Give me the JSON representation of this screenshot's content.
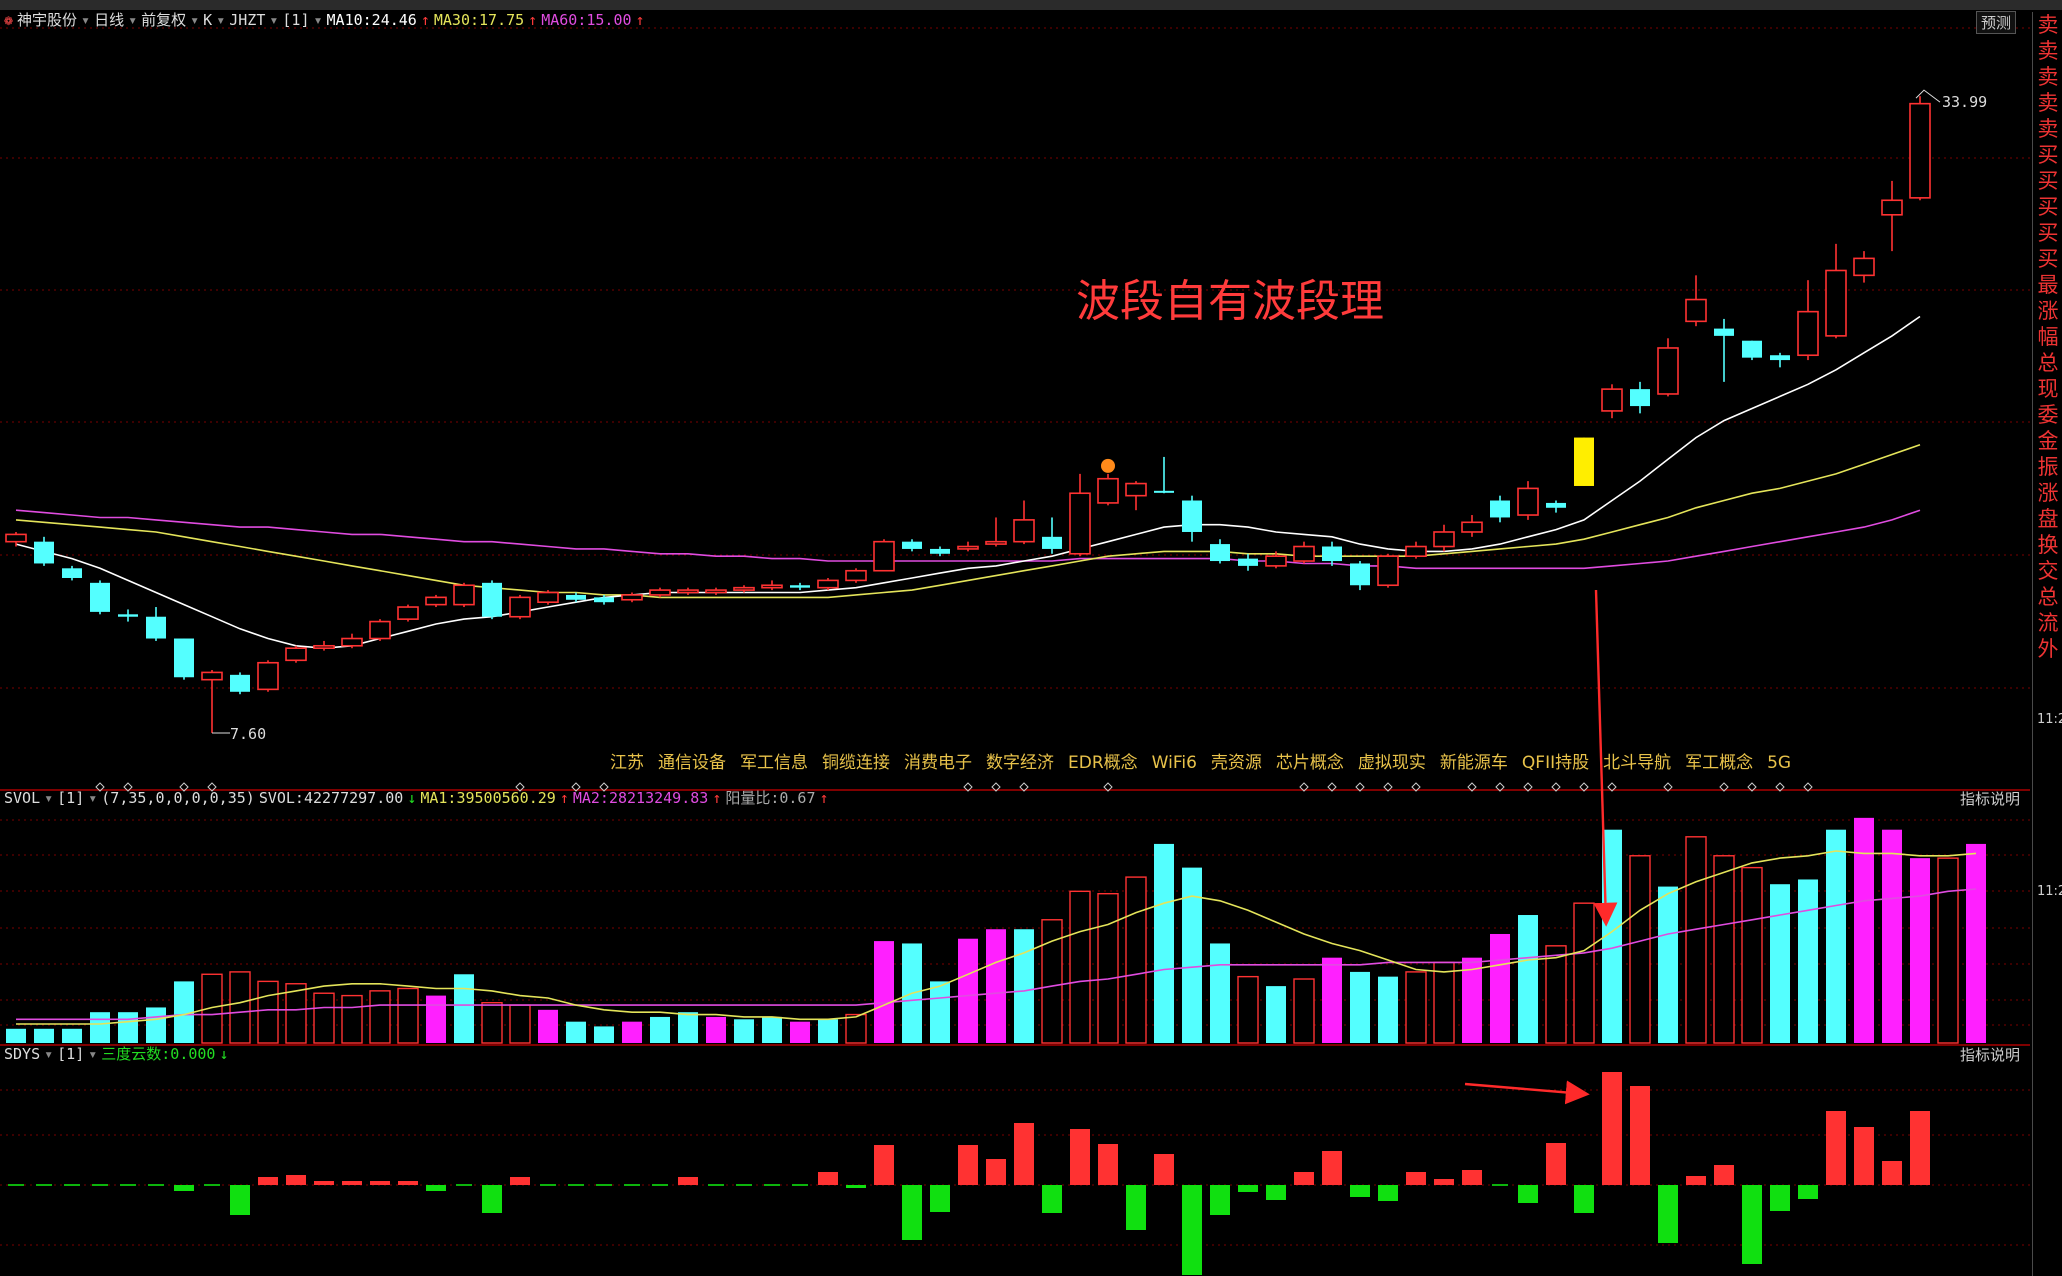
{
  "header": {
    "stock_name": "神宇股份",
    "period": "日线",
    "adjust": "前复权",
    "chart_kind": "K",
    "indicator": "JHZT",
    "bracket": "[1]",
    "ma10": "MA10:24.46",
    "ma30": "MA30:17.75",
    "ma60": "MA60:15.00",
    "forecast_button": "预测"
  },
  "volume_header": {
    "name": "SVOL",
    "bracket": "[1]",
    "params": "(7,35,0,0,0,0,35)",
    "svol": "SVOL:42277297.00",
    "ma1": "MA1:39500560.29",
    "ma2": "MA2:28213249.83",
    "ratio": "阳量比:0.67",
    "help": "指标说明"
  },
  "sdys_header": {
    "name": "SDYS",
    "bracket": "[1]",
    "value": "三度云数:0.000",
    "help": "指标说明"
  },
  "annotation": "波段自有波段理",
  "concepts": [
    "江苏",
    "通信设备",
    "军工信息",
    "铜缆连接",
    "消费电子",
    "数字经济",
    "EDR概念",
    "WiFi6",
    "壳资源",
    "芯片概念",
    "虚拟现实",
    "新能源车",
    "QFII持股",
    "北斗导航",
    "军工概念",
    "5G"
  ],
  "right_panel": {
    "chars": [
      "卖",
      "卖",
      "卖",
      "卖",
      "卖",
      "买",
      "买",
      "买",
      "买",
      "买",
      "最",
      "涨",
      "幅",
      "总",
      "现",
      "委",
      "金",
      "振",
      "涨",
      "盘",
      "换",
      "交",
      "总",
      "流",
      "外"
    ],
    "time1": "11:2",
    "time2": "11:2"
  },
  "colors": {
    "up": "#ff3232",
    "down": "#54ffff",
    "ma10": "#ffffff",
    "ma30": "#e4e45a",
    "ma60": "#e04ce0",
    "grid": "#7a0000",
    "magenta_bar": "#ff20ff",
    "highlight": "#ffee00",
    "sdys_up": "#ff3232",
    "sdys_down": "#10e010"
  },
  "chart_data": [
    {
      "type": "candlestick",
      "title": "神宇股份 日线 前复权",
      "ylim": [
        6.8,
        36
      ],
      "price_max_label": "33.99",
      "price_min_label": "7.60",
      "candles": [
        {
          "o": 15.9,
          "h": 16.3,
          "l": 15.7,
          "c": 16.2,
          "color": "up"
        },
        {
          "o": 15.9,
          "h": 16.1,
          "l": 14.9,
          "c": 15.0,
          "color": "down"
        },
        {
          "o": 14.8,
          "h": 14.9,
          "l": 14.3,
          "c": 14.4,
          "color": "down"
        },
        {
          "o": 14.2,
          "h": 14.3,
          "l": 12.9,
          "c": 13.0,
          "color": "down"
        },
        {
          "o": 12.9,
          "h": 13.1,
          "l": 12.6,
          "c": 12.8,
          "color": "down"
        },
        {
          "o": 12.8,
          "h": 13.2,
          "l": 11.8,
          "c": 11.9,
          "color": "down"
        },
        {
          "o": 11.9,
          "h": 11.9,
          "l": 10.2,
          "c": 10.3,
          "color": "down"
        },
        {
          "o": 10.2,
          "h": 10.6,
          "l": 8.0,
          "c": 10.5,
          "color": "up"
        },
        {
          "o": 10.4,
          "h": 10.5,
          "l": 9.6,
          "c": 9.7,
          "color": "down"
        },
        {
          "o": 9.8,
          "h": 11.0,
          "l": 9.7,
          "c": 10.9,
          "color": "up"
        },
        {
          "o": 11.0,
          "h": 11.6,
          "l": 10.9,
          "c": 11.5,
          "color": "up"
        },
        {
          "o": 11.5,
          "h": 11.8,
          "l": 11.4,
          "c": 11.6,
          "color": "up"
        },
        {
          "o": 11.6,
          "h": 12.1,
          "l": 11.5,
          "c": 11.9,
          "color": "up"
        },
        {
          "o": 11.9,
          "h": 12.7,
          "l": 11.8,
          "c": 12.6,
          "color": "up"
        },
        {
          "o": 12.7,
          "h": 13.3,
          "l": 12.6,
          "c": 13.2,
          "color": "up"
        },
        {
          "o": 13.3,
          "h": 13.7,
          "l": 13.2,
          "c": 13.6,
          "color": "up"
        },
        {
          "o": 13.3,
          "h": 14.2,
          "l": 13.2,
          "c": 14.1,
          "color": "up"
        },
        {
          "o": 14.2,
          "h": 14.3,
          "l": 12.7,
          "c": 12.8,
          "color": "down"
        },
        {
          "o": 12.8,
          "h": 13.7,
          "l": 12.7,
          "c": 13.6,
          "color": "up"
        },
        {
          "o": 13.4,
          "h": 13.9,
          "l": 13.3,
          "c": 13.8,
          "color": "up"
        },
        {
          "o": 13.7,
          "h": 13.8,
          "l": 13.4,
          "c": 13.5,
          "color": "down"
        },
        {
          "o": 13.6,
          "h": 13.7,
          "l": 13.3,
          "c": 13.4,
          "color": "down"
        },
        {
          "o": 13.5,
          "h": 13.8,
          "l": 13.4,
          "c": 13.7,
          "color": "up"
        },
        {
          "o": 13.7,
          "h": 14.0,
          "l": 13.6,
          "c": 13.9,
          "color": "up"
        },
        {
          "o": 13.9,
          "h": 14.0,
          "l": 13.7,
          "c": 13.8,
          "color": "up"
        },
        {
          "o": 13.8,
          "h": 14.0,
          "l": 13.7,
          "c": 13.9,
          "color": "up"
        },
        {
          "o": 13.9,
          "h": 14.1,
          "l": 13.8,
          "c": 14.0,
          "color": "up"
        },
        {
          "o": 14.0,
          "h": 14.3,
          "l": 13.9,
          "c": 14.1,
          "color": "up"
        },
        {
          "o": 14.1,
          "h": 14.2,
          "l": 13.9,
          "c": 14.0,
          "color": "down"
        },
        {
          "o": 14.0,
          "h": 14.4,
          "l": 13.9,
          "c": 14.3,
          "color": "up"
        },
        {
          "o": 14.3,
          "h": 14.8,
          "l": 14.2,
          "c": 14.7,
          "color": "up"
        },
        {
          "o": 14.7,
          "h": 16.0,
          "l": 14.7,
          "c": 15.9,
          "color": "up"
        },
        {
          "o": 15.9,
          "h": 16.0,
          "l": 15.5,
          "c": 15.6,
          "color": "down"
        },
        {
          "o": 15.6,
          "h": 15.7,
          "l": 15.3,
          "c": 15.4,
          "color": "down"
        },
        {
          "o": 15.6,
          "h": 15.9,
          "l": 15.5,
          "c": 15.7,
          "color": "up"
        },
        {
          "o": 15.8,
          "h": 16.9,
          "l": 15.7,
          "c": 15.9,
          "color": "up"
        },
        {
          "o": 15.9,
          "h": 17.6,
          "l": 15.8,
          "c": 16.8,
          "color": "up"
        },
        {
          "o": 16.1,
          "h": 16.9,
          "l": 15.4,
          "c": 15.6,
          "color": "down"
        },
        {
          "o": 15.4,
          "h": 18.7,
          "l": 15.3,
          "c": 17.9,
          "color": "up"
        },
        {
          "o": 17.5,
          "h": 18.7,
          "l": 17.4,
          "c": 18.5,
          "color": "up"
        },
        {
          "o": 17.8,
          "h": 18.4,
          "l": 17.2,
          "c": 18.3,
          "color": "up"
        },
        {
          "o": 18.0,
          "h": 19.4,
          "l": 17.9,
          "c": 18.0,
          "color": "down"
        },
        {
          "o": 17.6,
          "h": 17.8,
          "l": 15.9,
          "c": 16.3,
          "color": "down"
        },
        {
          "o": 15.8,
          "h": 16.0,
          "l": 15.0,
          "c": 15.1,
          "color": "down"
        },
        {
          "o": 15.2,
          "h": 15.4,
          "l": 14.7,
          "c": 14.9,
          "color": "down"
        },
        {
          "o": 14.9,
          "h": 15.5,
          "l": 14.8,
          "c": 15.3,
          "color": "up"
        },
        {
          "o": 15.1,
          "h": 15.9,
          "l": 15.0,
          "c": 15.7,
          "color": "up"
        },
        {
          "o": 15.7,
          "h": 15.9,
          "l": 14.9,
          "c": 15.1,
          "color": "down"
        },
        {
          "o": 15.0,
          "h": 15.1,
          "l": 13.9,
          "c": 14.1,
          "color": "down"
        },
        {
          "o": 14.1,
          "h": 15.4,
          "l": 14.0,
          "c": 15.3,
          "color": "up"
        },
        {
          "o": 15.3,
          "h": 15.9,
          "l": 15.2,
          "c": 15.7,
          "color": "up"
        },
        {
          "o": 15.7,
          "h": 16.6,
          "l": 15.5,
          "c": 16.3,
          "color": "up"
        },
        {
          "o": 16.3,
          "h": 17.0,
          "l": 16.1,
          "c": 16.7,
          "color": "up"
        },
        {
          "o": 16.9,
          "h": 17.8,
          "l": 16.7,
          "c": 17.6,
          "color": "down"
        },
        {
          "o": 17.0,
          "h": 18.4,
          "l": 16.8,
          "c": 18.1,
          "color": "up"
        },
        {
          "o": 17.3,
          "h": 17.6,
          "l": 17.1,
          "c": 17.5,
          "color": "down"
        },
        {
          "o": 18.2,
          "h": 20.2,
          "l": 18.2,
          "c": 20.2,
          "color": "highlight"
        },
        {
          "o": 21.3,
          "h": 22.4,
          "l": 21.0,
          "c": 22.2,
          "color": "up"
        },
        {
          "o": 22.2,
          "h": 22.5,
          "l": 21.2,
          "c": 21.5,
          "color": "down"
        },
        {
          "o": 22.0,
          "h": 24.3,
          "l": 21.9,
          "c": 23.9,
          "color": "up"
        },
        {
          "o": 25.0,
          "h": 26.9,
          "l": 24.8,
          "c": 25.9,
          "color": "up"
        },
        {
          "o": 24.7,
          "h": 25.1,
          "l": 22.5,
          "c": 24.4,
          "color": "down"
        },
        {
          "o": 24.2,
          "h": 24.2,
          "l": 23.4,
          "c": 23.5,
          "color": "down"
        },
        {
          "o": 23.6,
          "h": 23.7,
          "l": 23.1,
          "c": 23.4,
          "color": "down"
        },
        {
          "o": 23.6,
          "h": 26.7,
          "l": 23.4,
          "c": 25.4,
          "color": "up"
        },
        {
          "o": 24.4,
          "h": 28.2,
          "l": 24.3,
          "c": 27.1,
          "color": "up"
        },
        {
          "o": 26.9,
          "h": 27.9,
          "l": 26.6,
          "c": 27.6,
          "color": "up"
        },
        {
          "o": 29.4,
          "h": 30.8,
          "l": 27.9,
          "c": 30.0,
          "color": "up"
        },
        {
          "o": 30.1,
          "h": 34.3,
          "l": 30.0,
          "c": 33.99,
          "color": "up"
        }
      ],
      "ma10": [
        15.8,
        15.5,
        15.2,
        14.8,
        14.3,
        13.8,
        13.3,
        12.8,
        12.3,
        11.9,
        11.6,
        11.5,
        11.6,
        11.9,
        12.2,
        12.5,
        12.7,
        12.8,
        13.0,
        13.2,
        13.4,
        13.6,
        13.7,
        13.8,
        13.8,
        13.8,
        13.8,
        13.8,
        13.8,
        13.9,
        14.0,
        14.2,
        14.4,
        14.6,
        14.8,
        14.9,
        15.1,
        15.3,
        15.6,
        15.9,
        16.2,
        16.5,
        16.6,
        16.6,
        16.5,
        16.3,
        16.2,
        16.1,
        15.8,
        15.6,
        15.5,
        15.5,
        15.6,
        15.8,
        16.1,
        16.4,
        16.8,
        17.6,
        18.4,
        19.3,
        20.2,
        20.9,
        21.4,
        21.9,
        22.4,
        23.0,
        23.7,
        24.4,
        25.2
      ],
      "ma30": [
        16.8,
        16.7,
        16.6,
        16.5,
        16.4,
        16.3,
        16.1,
        15.9,
        15.7,
        15.5,
        15.3,
        15.1,
        14.9,
        14.7,
        14.5,
        14.3,
        14.1,
        14.0,
        13.9,
        13.8,
        13.8,
        13.7,
        13.7,
        13.6,
        13.6,
        13.6,
        13.6,
        13.6,
        13.6,
        13.6,
        13.7,
        13.8,
        13.9,
        14.1,
        14.3,
        14.5,
        14.7,
        14.9,
        15.1,
        15.3,
        15.4,
        15.5,
        15.5,
        15.5,
        15.4,
        15.4,
        15.3,
        15.3,
        15.3,
        15.3,
        15.3,
        15.4,
        15.5,
        15.6,
        15.7,
        15.8,
        16.0,
        16.3,
        16.6,
        16.9,
        17.3,
        17.6,
        17.9,
        18.1,
        18.4,
        18.7,
        19.1,
        19.5,
        19.9
      ],
      "ma60": [
        17.2,
        17.1,
        17.0,
        16.9,
        16.9,
        16.8,
        16.7,
        16.6,
        16.5,
        16.5,
        16.4,
        16.3,
        16.2,
        16.2,
        16.1,
        16.0,
        15.9,
        15.9,
        15.8,
        15.7,
        15.6,
        15.6,
        15.5,
        15.4,
        15.4,
        15.3,
        15.3,
        15.2,
        15.2,
        15.1,
        15.1,
        15.1,
        15.1,
        15.1,
        15.1,
        15.1,
        15.1,
        15.1,
        15.2,
        15.2,
        15.2,
        15.2,
        15.2,
        15.2,
        15.1,
        15.1,
        15.0,
        15.0,
        14.9,
        14.9,
        14.8,
        14.8,
        14.8,
        14.8,
        14.8,
        14.8,
        14.8,
        14.9,
        15.0,
        15.1,
        15.3,
        15.5,
        15.7,
        15.9,
        16.1,
        16.3,
        16.5,
        16.8,
        17.2
      ]
    },
    {
      "type": "bar",
      "title": "SVOL",
      "ylim": [
        0,
        1
      ],
      "volume": [
        0.06,
        0.06,
        0.06,
        0.13,
        0.13,
        0.15,
        0.26,
        0.29,
        0.3,
        0.26,
        0.25,
        0.21,
        0.2,
        0.22,
        0.23,
        0.2,
        0.29,
        0.17,
        0.16,
        0.14,
        0.09,
        0.07,
        0.09,
        0.11,
        0.13,
        0.11,
        0.1,
        0.11,
        0.09,
        0.1,
        0.12,
        0.43,
        0.42,
        0.26,
        0.44,
        0.48,
        0.48,
        0.52,
        0.64,
        0.63,
        0.7,
        0.84,
        0.74,
        0.42,
        0.28,
        0.24,
        0.27,
        0.36,
        0.3,
        0.28,
        0.3,
        0.34,
        0.36,
        0.46,
        0.54,
        0.41,
        0.59,
        0.9,
        0.79,
        0.66,
        0.87,
        0.79,
        0.74,
        0.67,
        0.69,
        0.9,
        0.95,
        0.9,
        0.78,
        0.78,
        0.84
      ],
      "bar_style": [
        "c",
        "c",
        "c",
        "c",
        "c",
        "c",
        "c",
        "h",
        "h",
        "h",
        "h",
        "h",
        "h",
        "h",
        "h",
        "m",
        "c",
        "h",
        "h",
        "m",
        "c",
        "c",
        "m",
        "c",
        "c",
        "m",
        "c",
        "c",
        "m",
        "c",
        "h",
        "m",
        "c",
        "c",
        "m",
        "m",
        "c",
        "h",
        "h",
        "h",
        "h",
        "c",
        "c",
        "c",
        "h",
        "c",
        "h",
        "m",
        "c",
        "c",
        "h",
        "h",
        "m",
        "m",
        "c",
        "h",
        "h",
        "c",
        "h",
        "c",
        "h",
        "h",
        "h",
        "c",
        "c",
        "c",
        "m",
        "m",
        "m",
        "h",
        "m"
      ],
      "ma1": [
        0.08,
        0.08,
        0.08,
        0.08,
        0.09,
        0.1,
        0.12,
        0.15,
        0.17,
        0.2,
        0.22,
        0.24,
        0.25,
        0.25,
        0.24,
        0.23,
        0.23,
        0.22,
        0.2,
        0.19,
        0.16,
        0.14,
        0.13,
        0.13,
        0.12,
        0.12,
        0.11,
        0.11,
        0.1,
        0.1,
        0.11,
        0.16,
        0.21,
        0.24,
        0.29,
        0.34,
        0.38,
        0.43,
        0.47,
        0.5,
        0.55,
        0.59,
        0.62,
        0.6,
        0.56,
        0.51,
        0.46,
        0.42,
        0.39,
        0.35,
        0.31,
        0.3,
        0.31,
        0.33,
        0.35,
        0.36,
        0.39,
        0.47,
        0.56,
        0.63,
        0.68,
        0.72,
        0.76,
        0.78,
        0.79,
        0.81,
        0.8,
        0.8,
        0.79,
        0.79,
        0.8
      ],
      "ma2": [
        0.1,
        0.1,
        0.1,
        0.1,
        0.1,
        0.11,
        0.12,
        0.12,
        0.13,
        0.14,
        0.14,
        0.15,
        0.15,
        0.16,
        0.16,
        0.16,
        0.16,
        0.16,
        0.16,
        0.16,
        0.16,
        0.16,
        0.16,
        0.16,
        0.16,
        0.16,
        0.16,
        0.16,
        0.16,
        0.16,
        0.16,
        0.17,
        0.18,
        0.19,
        0.2,
        0.21,
        0.22,
        0.24,
        0.26,
        0.27,
        0.29,
        0.31,
        0.32,
        0.33,
        0.33,
        0.33,
        0.33,
        0.33,
        0.33,
        0.34,
        0.34,
        0.34,
        0.34,
        0.35,
        0.36,
        0.37,
        0.38,
        0.4,
        0.43,
        0.46,
        0.48,
        0.5,
        0.52,
        0.54,
        0.56,
        0.58,
        0.6,
        0.61,
        0.62,
        0.64,
        0.65
      ]
    },
    {
      "type": "bar",
      "title": "SDYS",
      "ylim": [
        -1,
        1
      ],
      "values": [
        0,
        0,
        0,
        0,
        0,
        0,
        -0.06,
        0,
        -0.3,
        0.08,
        0.1,
        0.04,
        0.04,
        0.04,
        0.04,
        -0.06,
        0,
        -0.28,
        0.08,
        0,
        0,
        0,
        0,
        0,
        0.08,
        0,
        0,
        0,
        0,
        0.13,
        -0.03,
        0.4,
        -0.55,
        -0.27,
        0.4,
        0.26,
        0.62,
        -0.28,
        0.56,
        0.41,
        -0.45,
        0.31,
        -0.9,
        -0.3,
        -0.07,
        -0.15,
        0.13,
        0.34,
        -0.12,
        -0.16,
        0.13,
        0.06,
        0.15,
        0,
        -0.18,
        0.42,
        -0.28,
        1.13,
        0.99,
        -0.58,
        0.09,
        0.2,
        -0.79,
        -0.26,
        -0.14,
        0.74,
        0.58,
        0.24,
        0.74
      ]
    }
  ]
}
